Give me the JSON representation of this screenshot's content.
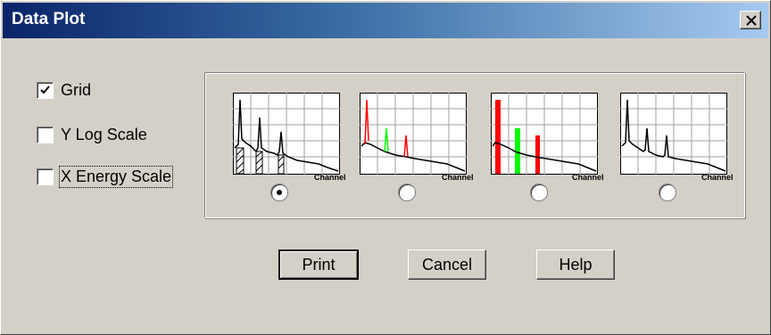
{
  "window": {
    "title": "Data Plot"
  },
  "options": [
    {
      "label": "Grid",
      "checked": true
    },
    {
      "label": "Y Log Scale",
      "checked": false
    },
    {
      "label": "X Energy Scale",
      "checked": false
    }
  ],
  "plot_styles": [
    {
      "axis_label": "Channel",
      "selected": true,
      "style": "hatched-black"
    },
    {
      "axis_label": "Channel",
      "selected": false,
      "style": "colored-lines"
    },
    {
      "axis_label": "Channel",
      "selected": false,
      "style": "colored-filled"
    },
    {
      "axis_label": "Channel",
      "selected": false,
      "style": "black-lines"
    }
  ],
  "buttons": {
    "print": "Print",
    "cancel": "Cancel",
    "help": "Help"
  },
  "colors": {
    "title_start": "#0a246a",
    "title_end": "#a6caf0",
    "peak_red": "#ff0000",
    "peak_green": "#00ff00",
    "face": "#d4d0c8"
  }
}
